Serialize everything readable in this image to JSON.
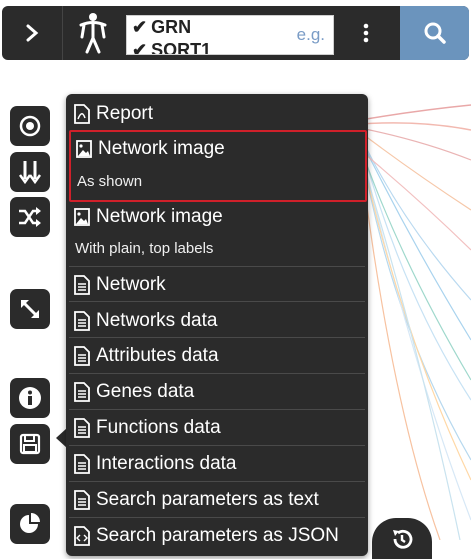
{
  "toolbar": {
    "query_lines": [
      "GRN",
      "SORT1"
    ],
    "placeholder_hint": "e.g."
  },
  "menu": {
    "items": [
      {
        "label": "Report",
        "icon": "pdf-icon"
      },
      {
        "label": "Network image",
        "sublabel": "As shown",
        "icon": "image-icon",
        "selected": true
      },
      {
        "label": "Network image",
        "sublabel": "With plain, top labels",
        "icon": "image-icon"
      },
      {
        "label": "Network",
        "icon": "document-icon"
      },
      {
        "label": "Networks data",
        "icon": "document-icon"
      },
      {
        "label": "Attributes data",
        "icon": "document-icon"
      },
      {
        "label": "Genes data",
        "icon": "document-icon"
      },
      {
        "label": "Functions data",
        "icon": "document-icon"
      },
      {
        "label": "Interactions data",
        "icon": "document-icon"
      },
      {
        "label": "Search parameters as text",
        "icon": "document-icon"
      },
      {
        "label": "Search parameters as JSON",
        "icon": "code-document-icon"
      }
    ]
  },
  "colors": {
    "panel": "#2b2b2b",
    "search_button": "#6b94bd",
    "selection_border": "#d0202a",
    "hint_text": "#7a9cc6"
  }
}
